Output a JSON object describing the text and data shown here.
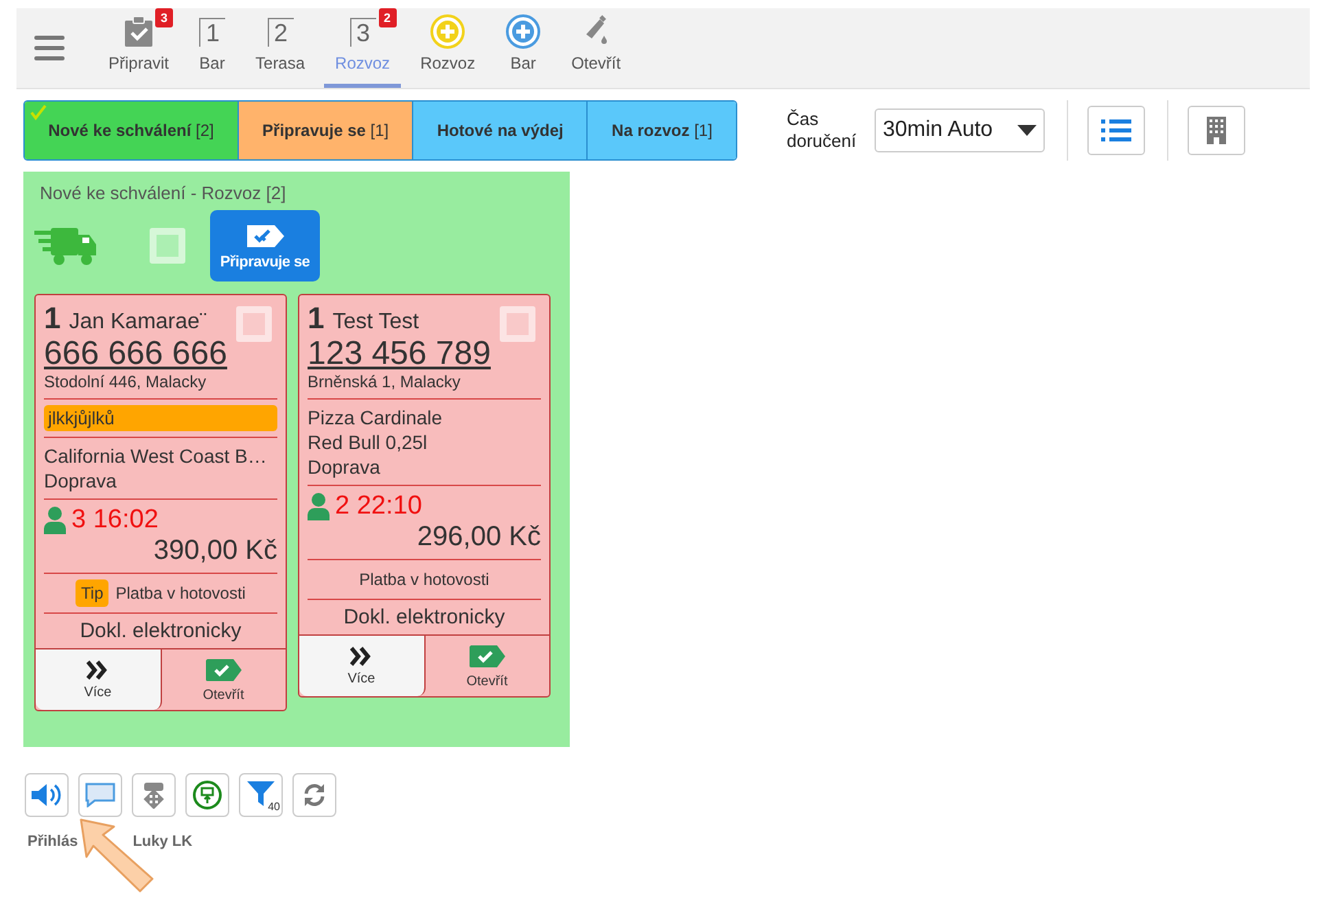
{
  "toolbar": {
    "tabs": [
      {
        "kind": "clipboard",
        "label": "Připravit",
        "badge": "3",
        "selected": false
      },
      {
        "kind": "number",
        "digit": "1",
        "label": "Bar",
        "selected": false
      },
      {
        "kind": "number",
        "digit": "2",
        "label": "Terasa",
        "selected": false
      },
      {
        "kind": "number",
        "digit": "3",
        "label": "Rozvoz",
        "badge": "2",
        "selected": true
      },
      {
        "kind": "plus",
        "color": "#f2d21b",
        "label": "Rozvoz",
        "selected": false
      },
      {
        "kind": "plus",
        "color": "#4a9be0",
        "label": "Bar",
        "selected": false
      },
      {
        "kind": "bottle",
        "label": "Otevřít",
        "selected": false
      }
    ]
  },
  "status_tabs": [
    {
      "label": "Nové ke schválení",
      "count": "[2]",
      "color": "#44d455",
      "checked": true
    },
    {
      "label": "Připravuje se",
      "count": "[1]",
      "color": "#ffb36b",
      "checked": false
    },
    {
      "label": "Hotové na výdej",
      "color": "#5ac8fa",
      "checked": false
    },
    {
      "label": "Na rozvoz",
      "count": "[1]",
      "color": "#5ac8fa",
      "checked": false
    }
  ],
  "delivery_time": {
    "label": "Čas doručení",
    "value": "30min Auto"
  },
  "panel": {
    "title": "Nové ke schválení - Rozvoz [2]",
    "checked": false,
    "action": "Připravuje se",
    "orders": [
      {
        "number": "1",
        "name": "Jan Kamarae¨",
        "phone": "666 666 666",
        "address": "Stodolní 446, Malacky",
        "note": "jlkkjůjlků",
        "items": [
          "California West Coast B…",
          "Doprava"
        ],
        "guests": "3",
        "time": "16:02",
        "price": "390,00 Kč",
        "tip": "Tip",
        "payment": "Platba v hotovosti",
        "receipt": "Dokl. elektronicky",
        "checked": false,
        "more": "Více",
        "open": "Otevřít"
      },
      {
        "number": "1",
        "name": "Test Test",
        "phone": "123 456 789",
        "address": "Brněnská 1, Malacky",
        "items": [
          "Pizza Cardinale",
          "Red Bull 0,25l",
          "Doprava"
        ],
        "guests": "2",
        "time": "22:10",
        "price": "296,00 Kč",
        "payment": "Platba v hotovosti",
        "receipt": "Dokl. elektronicky",
        "checked": false,
        "more": "Více",
        "open": "Otevřít"
      }
    ]
  },
  "bottom_tools": [
    {
      "kind": "sound"
    },
    {
      "kind": "chat"
    },
    {
      "kind": "move"
    },
    {
      "kind": "screen"
    },
    {
      "kind": "filter",
      "count": "40"
    },
    {
      "kind": "refresh"
    }
  ],
  "login": {
    "text_start": "Přihlás",
    "text_end": "Luky LK"
  }
}
